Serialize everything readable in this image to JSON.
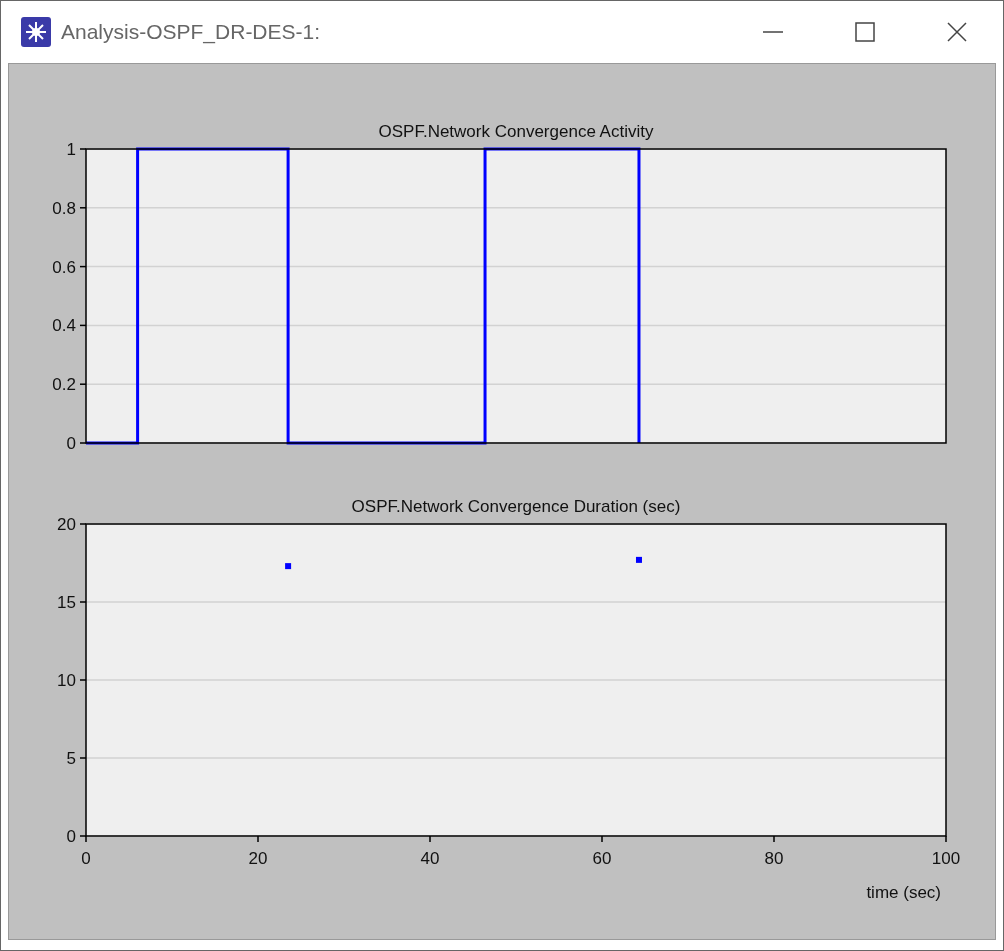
{
  "window": {
    "title": "Analysis-OSPF_DR-DES-1:"
  },
  "charts": [
    {
      "chart_data": {
        "type": "line",
        "title": "OSPF.Network Convergence Activity",
        "xlim": [
          0,
          100
        ],
        "ylim": [
          0,
          1
        ],
        "yticks": [
          {
            "value": 0,
            "label": "0"
          },
          {
            "value": 0.2,
            "label": "0.2"
          },
          {
            "value": 0.4,
            "label": "0.4"
          },
          {
            "value": 0.6,
            "label": "0.6"
          },
          {
            "value": 0.8,
            "label": "0.8"
          },
          {
            "value": 1,
            "label": "1"
          }
        ],
        "x": [
          0,
          6,
          6,
          23.5,
          23.5,
          46.4,
          46.4,
          64.3,
          64.3
        ],
        "grid": true,
        "series": [
          {
            "color": "#0000ff",
            "values": [
              0,
              0,
              1,
              1,
              0,
              0,
              1,
              1,
              0
            ]
          }
        ]
      }
    },
    {
      "chart_data": {
        "type": "scatter",
        "title": "OSPF.Network Convergence Duration (sec)",
        "xlabel": "time (sec)",
        "xlim": [
          0,
          100
        ],
        "ylim": [
          0,
          20
        ],
        "xticks": [
          0,
          20,
          40,
          60,
          80,
          100
        ],
        "yticks": [
          0,
          5,
          10,
          15,
          20
        ],
        "x": [
          23.5,
          64.3
        ],
        "grid": true,
        "series": [
          {
            "color": "#0000ff",
            "values": [
              17.3,
              17.7
            ]
          }
        ]
      }
    }
  ]
}
